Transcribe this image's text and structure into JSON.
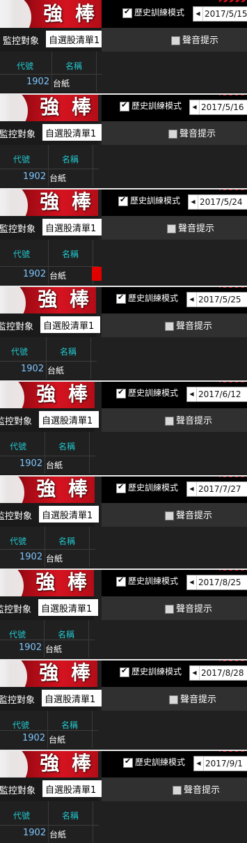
{
  "app": {
    "banner_title": "強 棒",
    "monitor_label": "監控對象",
    "list_value": "自選股清單1",
    "history_mode_label": "歷史訓練模式",
    "sound_label": "聲音提示",
    "col_code": "代號",
    "col_name": "名稱",
    "row_code": "1902",
    "row_name": "台紙",
    "date_arrow": "◀",
    "history_checked": true,
    "sound_checked": false
  },
  "snapshots": [
    {
      "date": "2017/5/15"
    },
    {
      "date": "2017/5/16"
    },
    {
      "date": "2017/5/24"
    },
    {
      "date": "2017/5/25"
    },
    {
      "date": "2017/6/12"
    },
    {
      "date": "2017/7/27"
    },
    {
      "date": "2017/8/25"
    },
    {
      "date": "2017/8/28"
    },
    {
      "date": "2017/9/1"
    }
  ],
  "colors": {
    "banner_red": "#d51320",
    "header_cyan": "#21c8cf",
    "code_blue": "#7fc6ff",
    "marker_red": "#e00000"
  }
}
